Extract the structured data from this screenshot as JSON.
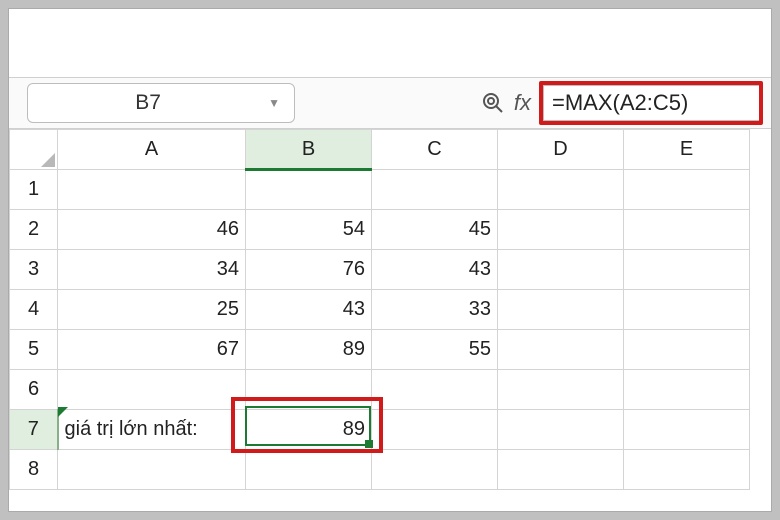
{
  "formula_bar": {
    "name_box": "B7",
    "fx_label": "fx",
    "formula": "=MAX(A2:C5)"
  },
  "columns": {
    "A": "A",
    "B": "B",
    "C": "C",
    "D": "D",
    "E": "E"
  },
  "row_labels": {
    "1": "1",
    "2": "2",
    "3": "3",
    "4": "4",
    "5": "5",
    "6": "6",
    "7": "7",
    "8": "8"
  },
  "cells": {
    "A2": "46",
    "B2": "54",
    "C2": "45",
    "A3": "34",
    "B3": "76",
    "C3": "43",
    "A4": "25",
    "B4": "43",
    "C4": "33",
    "A5": "67",
    "B5": "89",
    "C5": "55",
    "A7": "giá trị lớn nhất:",
    "B7": "89"
  },
  "active_cell": "B7"
}
